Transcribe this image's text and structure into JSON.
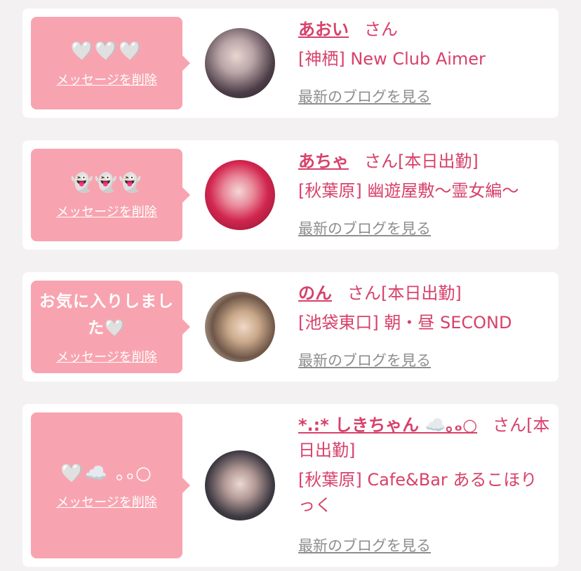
{
  "delete_label": "メッセージを削除",
  "blog_label": "最新のブログを見る",
  "honorific": "さん",
  "cards": [
    {
      "message": "🤍🤍🤍",
      "name": "あおい",
      "status": "",
      "shop": "[神栖] New Club Aimer"
    },
    {
      "message": "👻👻👻",
      "name": "あちゃ",
      "status": "[本日出勤]",
      "shop": "[秋葉原] 幽遊屋敷〜霊女編〜"
    },
    {
      "message": "お気に入りしました🤍",
      "name": "のん",
      "status": "[本日出勤]",
      "shop": "[池袋東口] 朝・昼 SECOND"
    },
    {
      "message": "🤍☁️ ｡ₒ○",
      "name": "*.:* しきちゃん ☁️｡ₒ○",
      "status": "[本日出勤]",
      "shop": "[秋葉原] Cafe&Bar あるこほりっく"
    }
  ],
  "colors": {
    "accent": "#d7416a",
    "bubble": "#f8a4b0",
    "background": "#f3f1f2",
    "link_gray": "#8e8e8e"
  }
}
